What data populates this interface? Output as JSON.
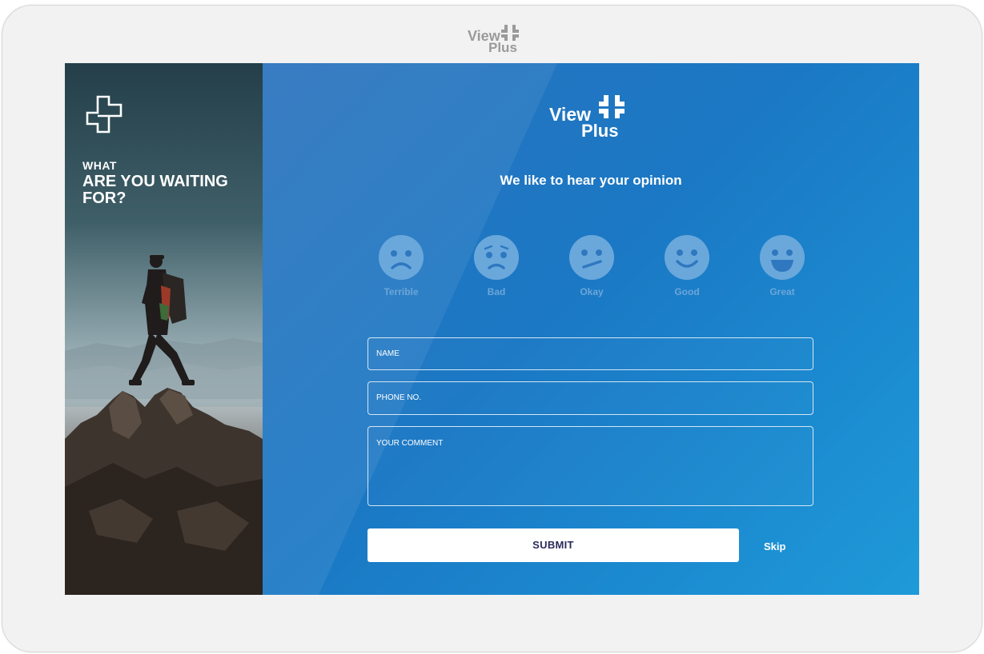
{
  "device": {
    "brand_view": "View",
    "brand_plus": "Plus"
  },
  "left_panel": {
    "tagline_small": "WHAT",
    "tagline_big": "ARE YOU WAITING FOR?"
  },
  "main": {
    "logo_view": "View",
    "logo_plus": "Plus",
    "heading": "We like to hear your opinion",
    "ratings": [
      {
        "label": "Terrible",
        "icon": "terrible-face-icon"
      },
      {
        "label": "Bad",
        "icon": "bad-face-icon"
      },
      {
        "label": "Okay",
        "icon": "okay-face-icon"
      },
      {
        "label": "Good",
        "icon": "good-face-icon"
      },
      {
        "label": "Great",
        "icon": "great-face-icon"
      }
    ],
    "form": {
      "name_placeholder": "NAME",
      "phone_placeholder": "PHONE NO.",
      "comment_placeholder": "YOUR COMMENT",
      "submit_label": "SUBMIT",
      "skip_label": "Skip"
    }
  },
  "colors": {
    "panel_blue": "#1b78c4",
    "face_fill": "#6aa8dc",
    "face_feature": "#2f78c0",
    "submit_text": "#2b2a5a"
  }
}
